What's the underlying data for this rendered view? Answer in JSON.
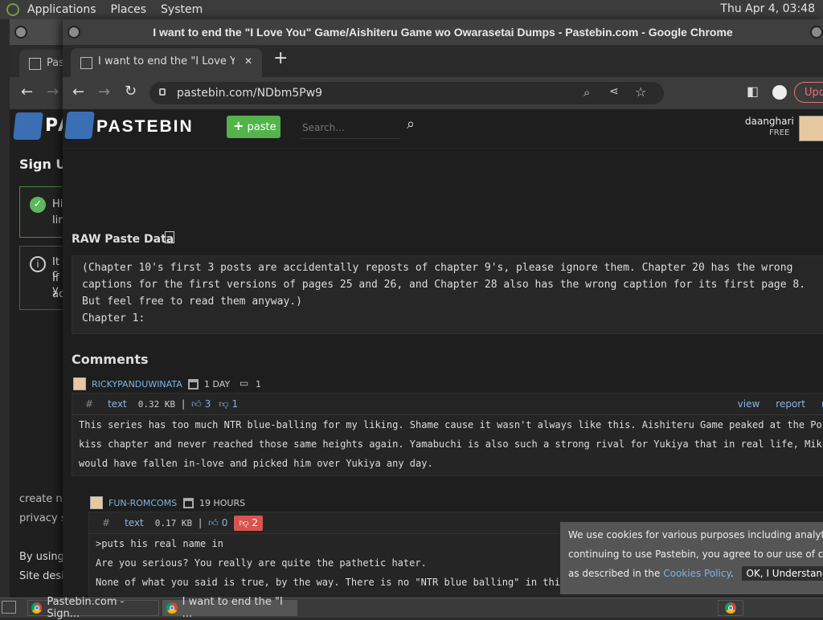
{
  "top_panel": {
    "menu": [
      "Applications",
      "Places",
      "System"
    ],
    "clock": "Thu Apr  4, 03:48"
  },
  "bg_window": {
    "tab_label": "Pas",
    "logo_text": "PA",
    "sign_up": "Sign U",
    "notice1": [
      "Hi",
      "lin"
    ],
    "notice2": [
      "It c",
      "If y",
      "ac"
    ],
    "footer": [
      "create ne",
      "privacy st",
      "By using",
      "Site desig"
    ]
  },
  "window": {
    "title": "I want to end the \"I Love You\" Game/Aishiteru Game wo Owarasetai Dumps - Pastebin.com - Google Chrome"
  },
  "tab": {
    "title": "I want to end the \"I Love You\"",
    "close": "✕",
    "new_tab": "+"
  },
  "toolbar": {
    "url": "pastebin.com/NDbm5Pw9",
    "update_label": "Upd"
  },
  "pastebin": {
    "brand": "PASTEBIN",
    "paste_button": "paste",
    "search_placeholder": "Search...",
    "username": "daanghari",
    "plan": "FREE"
  },
  "raw": {
    "heading": "RAW Paste Data",
    "lines": [
      "(Chapter 10's first 3 posts are accidentally reposts of chapter 9's, please ignore them. Chapter 20 has the wrong",
      "captions for the first versions of pages 25 and 26, and Chapter 28 also has the wrong caption for its first page 8.",
      "But feel free to read them anyway.)",
      "Chapter 1:"
    ]
  },
  "comments": {
    "heading": "Comments",
    "items": [
      {
        "user": "RICKYPANDUWINATA",
        "age": "1 DAY",
        "reply_count": "1",
        "hash": "#",
        "syntax": "text",
        "size": "0.32 KB",
        "sep": "|",
        "likes": "3",
        "dislikes": "1",
        "actions": [
          "view",
          "report",
          "re"
        ],
        "lines": [
          "This series has too much NTR blue-balling for my liking. Shame cause it wasn't always like this. Aishiteru Game peaked at the Poc",
          "kiss chapter and never reached those same heights again. Yamabuchi is also such a strong rival for Yukiya that in real life, Miku",
          "would have fallen in-love and picked him over Yukiya any day."
        ]
      },
      {
        "user": "FUN-ROMCOMS",
        "age": "19 HOURS",
        "hash": "#",
        "syntax": "text",
        "size": "0.17 KB",
        "sep": "|",
        "likes": "0",
        "dislikes": "2",
        "lines": [
          ">puts his real name in",
          "Are you serious? You really are quite the pathetic hater.",
          "None of what you said is true, by the way. There is no \"NTR blue balling\" in this series."
        ]
      }
    ]
  },
  "cookie": {
    "line1": "We use cookies for various purposes including analytics. By",
    "line2": "continuing to use Pastebin, you agree to our use of cookies",
    "line3_pre": "as described in the ",
    "policy_link": "Cookies Policy",
    "line3_post": ".",
    "ok_button": "OK, I Understand"
  },
  "taskbar": {
    "items": [
      "Pastebin.com - Sign...",
      "I want to end the \"I ..."
    ]
  }
}
